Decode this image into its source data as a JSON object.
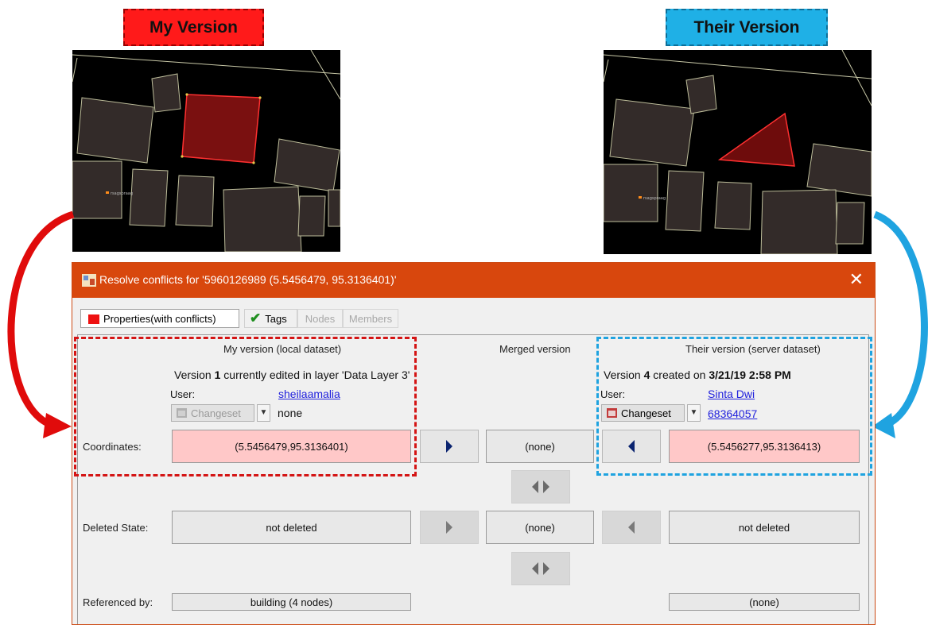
{
  "labels": {
    "my_version": "My Version",
    "their_version": "Their Version"
  },
  "colors": {
    "my_accent": "#ff1a1a",
    "their_accent": "#1fb0e6",
    "titlebar": "#d8470d",
    "conflict_field": "#ffc8c8"
  },
  "map": {
    "point_label": "rsagspraag"
  },
  "dialog": {
    "title": "Resolve conflicts for '5960126989 (5.5456479, 95.3136401)'",
    "close_icon": "close-icon",
    "tabs": [
      {
        "label": "Properties(with conflicts)",
        "active": true
      },
      {
        "label": "Tags",
        "enabled": true
      },
      {
        "label": "Nodes",
        "enabled": false
      },
      {
        "label": "Members",
        "enabled": false
      }
    ],
    "columns": {
      "mine": "My version (local dataset)",
      "merged": "Merged version",
      "theirs": "Their version (server dataset)"
    },
    "mine": {
      "version_prefix": "Version ",
      "version_num": "1",
      "version_suffix": " currently edited in layer 'Data Layer 3'",
      "user_label": "User:",
      "user": "sheilaamalia",
      "changeset_label": "Changeset",
      "changeset_value": "none"
    },
    "theirs": {
      "version_prefix": "Version ",
      "version_num": "4",
      "version_mid": " created on ",
      "version_date": "3/21/19 2:58 PM",
      "user_label": "User:",
      "user": "Sinta Dwi",
      "changeset_label": "Changeset",
      "changeset_value": "68364057"
    },
    "rows": {
      "coordinates": {
        "label": "Coordinates:",
        "mine": "(5.5456479,95.3136401)",
        "merged": "(none)",
        "theirs": "(5.5456277,95.3136413)"
      },
      "deleted_state": {
        "label": "Deleted State:",
        "mine": "not deleted",
        "merged": "(none)",
        "theirs": "not deleted"
      },
      "referenced_by": {
        "label": "Referenced by:",
        "mine": "building (4 nodes)",
        "theirs": "(none)"
      }
    }
  }
}
